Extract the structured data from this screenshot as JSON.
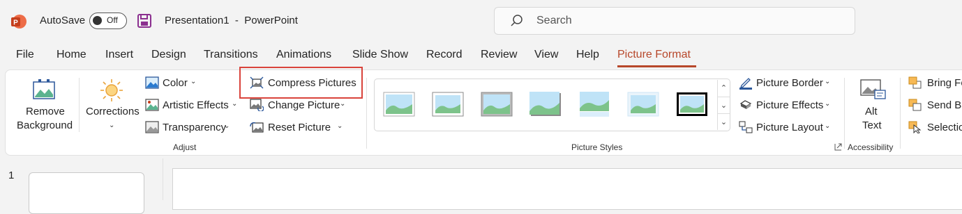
{
  "titlebar": {
    "autosave_label": "AutoSave",
    "autosave_state": "Off",
    "doc_title": "Presentation1  -  PowerPoint",
    "search_placeholder": "Search"
  },
  "tabs": [
    "File",
    "Home",
    "Insert",
    "Design",
    "Transitions",
    "Animations",
    "Slide Show",
    "Record",
    "Review",
    "View",
    "Help",
    "Picture Format"
  ],
  "active_tab": "Picture Format",
  "ribbon": {
    "adjust": {
      "remove_bg_line1": "Remove",
      "remove_bg_line2": "Background",
      "corrections": "Corrections",
      "color": "Color",
      "artistic_effects": "Artistic Effects",
      "transparency": "Transparency",
      "compress_pictures": "Compress Pictures",
      "change_picture": "Change Picture",
      "reset_picture": "Reset Picture",
      "group_label": "Adjust"
    },
    "picture_styles": {
      "group_label": "Picture Styles",
      "picture_border": "Picture Border",
      "picture_effects": "Picture Effects",
      "picture_layout": "Picture Layout"
    },
    "accessibility": {
      "alt_line1": "Alt",
      "alt_line2": "Text",
      "group_label": "Accessibility"
    },
    "arrange": {
      "bring_forward": "Bring Fo",
      "send_backward": "Send Ba",
      "selection": "Selectio"
    }
  },
  "slides": {
    "number": "1"
  },
  "colors": {
    "accent": "#b7472a",
    "highlight": "#d9433b",
    "brand": "#c43e1c"
  }
}
